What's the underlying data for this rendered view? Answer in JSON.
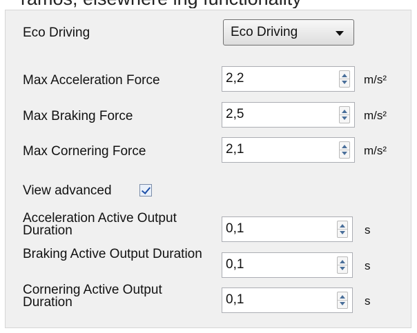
{
  "top_partial_text": "ramos, elsewhere ing functionality",
  "eco_driving": {
    "label": "Eco Driving",
    "selected": "Eco Driving"
  },
  "forces": [
    {
      "label": "Max Acceleration Force",
      "value": "2,2",
      "unit": "m/s²"
    },
    {
      "label": "Max Braking Force",
      "value": "2,5",
      "unit": "m/s²"
    },
    {
      "label": "Max Cornering Force",
      "value": "2,1",
      "unit": "m/s²"
    }
  ],
  "advanced": {
    "label": "View advanced",
    "checked": true
  },
  "durations": [
    {
      "label": "Acceleration Active Output Duration",
      "value": "0,1",
      "unit": "s"
    },
    {
      "label": "Braking Active Output Duration",
      "value": "0,1",
      "unit": "s"
    },
    {
      "label": "Cornering Active Output Duration",
      "value": "0,1",
      "unit": "s"
    }
  ]
}
